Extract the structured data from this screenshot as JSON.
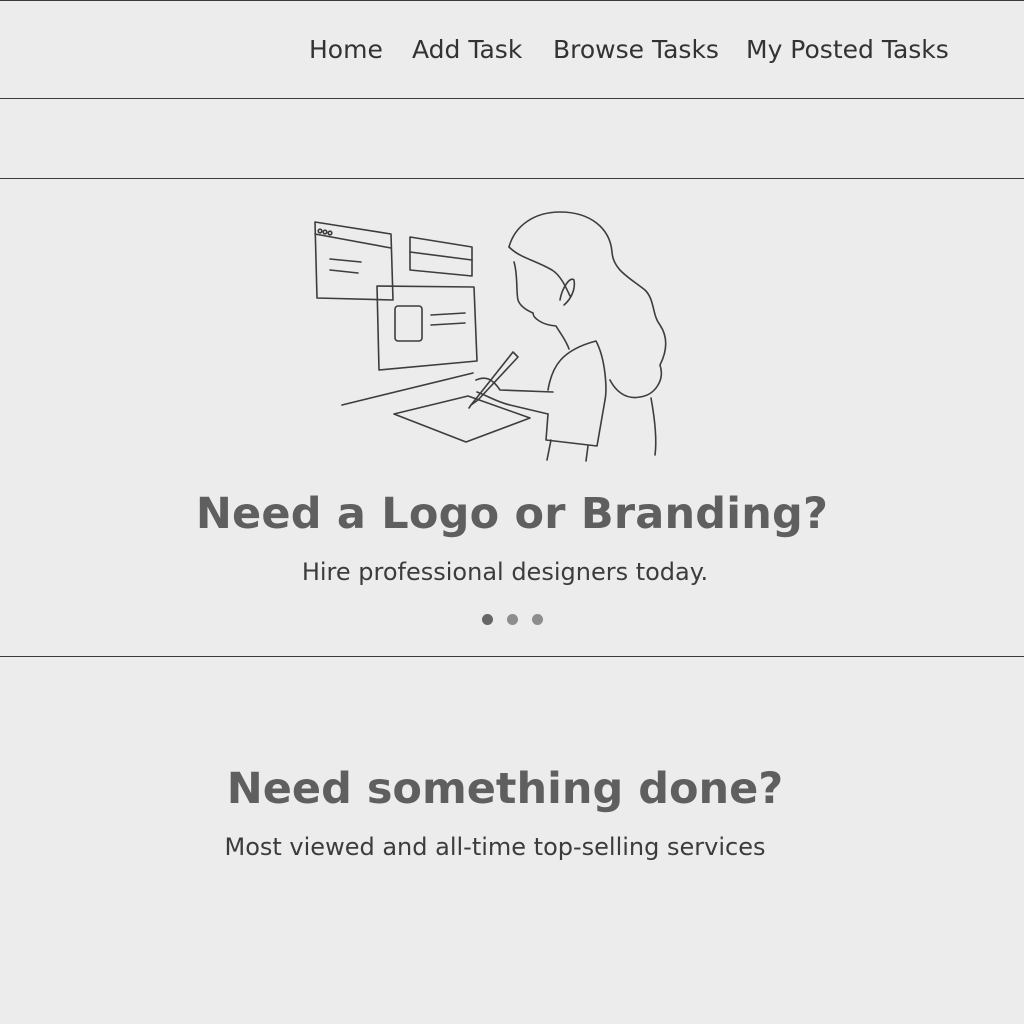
{
  "nav": {
    "items": [
      {
        "label": "Home"
      },
      {
        "label": "Add Task"
      },
      {
        "label": "Browse Tasks"
      },
      {
        "label": "My Posted Tasks"
      }
    ]
  },
  "hero": {
    "illustration_icon": "designer-drawing-on-tablet-illustration",
    "title": "Need a Logo or Branding?",
    "subtitle": "Hire professional designers today.",
    "carousel": {
      "slide_count": 3,
      "active_index": 0
    }
  },
  "section": {
    "title": "Need something done?",
    "subtitle": "Most viewed and all-time top-selling services"
  },
  "colors": {
    "background": "#ececec",
    "border": "#3a3a3a",
    "heading": "#5f5f5f",
    "text": "#3c3c3c"
  }
}
